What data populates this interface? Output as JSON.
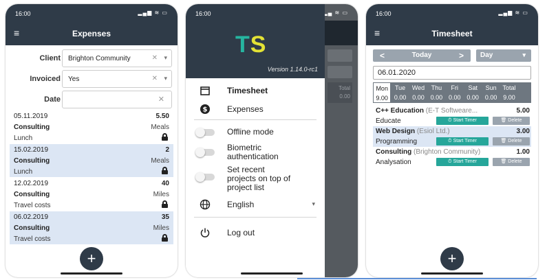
{
  "expenses_screen": {
    "status_time": "16:00",
    "title": "Expenses",
    "filters": {
      "client_label": "Client",
      "client_value": "Brighton Community",
      "invoiced_label": "Invoiced",
      "invoiced_value": "Yes",
      "date_label": "Date",
      "date_value": ""
    },
    "entries": [
      {
        "date": "05.11.2019",
        "amount": "5.50",
        "activity": "Consulting",
        "category": "Meals",
        "description": "Lunch"
      },
      {
        "date": "15.02.2019",
        "amount": "2",
        "activity": "Consulting",
        "category": "Meals",
        "description": "Lunch"
      },
      {
        "date": "12.02.2019",
        "amount": "40",
        "activity": "Consulting",
        "category": "Miles",
        "description": "Travel costs"
      },
      {
        "date": "06.02.2019",
        "amount": "35",
        "activity": "Consulting",
        "category": "Miles",
        "description": "Travel costs"
      }
    ],
    "fab_label": "+"
  },
  "menu_screen": {
    "status_time": "16:00",
    "logo_t": "T",
    "logo_s": "S",
    "version": "Version 1.14.0-rc1",
    "nav": [
      {
        "label": "Timesheet",
        "icon": "calendar-icon"
      },
      {
        "label": "Expenses",
        "icon": "dollar-circle-icon"
      }
    ],
    "toggles": [
      {
        "label": "Offline mode"
      },
      {
        "label_lines": [
          "Biometric",
          "authentication"
        ]
      },
      {
        "label_lines": [
          "Set recent",
          "projects on top of",
          "project list"
        ]
      }
    ],
    "language": "English",
    "logout": "Log out",
    "background_ghost": [
      "Total",
      "0.00"
    ]
  },
  "timesheet_screen": {
    "status_time": "16:00",
    "title": "Timesheet",
    "prev": "<",
    "today": "Today",
    "next": ">",
    "view": "Day",
    "date_value": "06.01.2020",
    "week": [
      {
        "day": "Mon",
        "value": "9.00"
      },
      {
        "day": "Tue",
        "value": "0.00"
      },
      {
        "day": "Wed",
        "value": "0.00"
      },
      {
        "day": "Thu",
        "value": "0.00"
      },
      {
        "day": "Fri",
        "value": "0.00"
      },
      {
        "day": "Sat",
        "value": "0.00"
      },
      {
        "day": "Sun",
        "value": "0.00"
      },
      {
        "day": "Total",
        "value": "9.00"
      }
    ],
    "entries": [
      {
        "activity": "C++ Education",
        "customer": "(E-T Softweare...",
        "hours": "5.00",
        "project": "Educate"
      },
      {
        "activity": "Web Design",
        "customer": "(Esiol Ltd.)",
        "hours": "3.00",
        "project": "Programming"
      },
      {
        "activity": "Consulting",
        "customer": "(Brighton Community)",
        "hours": "1.00",
        "project": "Analysation"
      }
    ],
    "start_timer": "⏱ Start Timer",
    "delete": "🗑 Delete",
    "fab_label": "+"
  },
  "colors": {
    "header": "#2f3b48",
    "accent_teal": "#26a69a",
    "logo_yellow": "#e3e235",
    "row_highlight": "#dce6f4"
  }
}
